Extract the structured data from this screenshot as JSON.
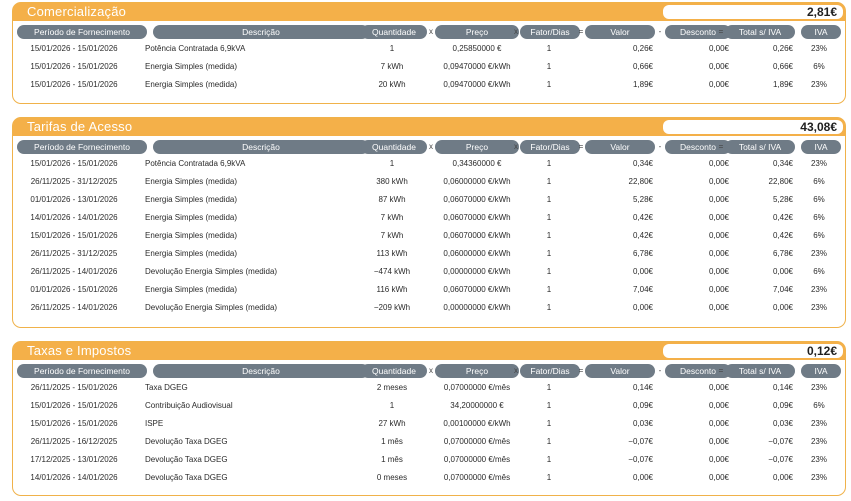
{
  "columns": {
    "periodo": "Período de Fornecimento",
    "descricao": "Descrição",
    "quantidade": "Quantidade",
    "preco": "Preço",
    "fator": "Fator/Dias",
    "valor": "Valor",
    "desconto": "Desconto",
    "total": "Total s/ IVA",
    "iva": "IVA",
    "op_x1": "x",
    "op_x2": "x",
    "op_eq1": "=",
    "op_minus": "-",
    "op_eq2": "="
  },
  "sections": [
    {
      "title": "Comercialização",
      "total": "2,81€",
      "rows": [
        {
          "periodo": "15/01/2026 - 15/01/2026",
          "descricao": "Potência Contratada 6,9kVA",
          "quantidade": "1",
          "preco": "0,25850000 €",
          "fator": "1",
          "valor": "0,26€",
          "desconto": "0,00€",
          "total": "0,26€",
          "iva": "23%"
        },
        {
          "periodo": "15/01/2026 - 15/01/2026",
          "descricao": "Energia Simples (medida)",
          "quantidade": "7 kWh",
          "preco": "0,09470000 €/kWh",
          "fator": "1",
          "valor": "0,66€",
          "desconto": "0,00€",
          "total": "0,66€",
          "iva": "6%"
        },
        {
          "periodo": "15/01/2026 - 15/01/2026",
          "descricao": "Energia Simples (medida)",
          "quantidade": "20 kWh",
          "preco": "0,09470000 €/kWh",
          "fator": "1",
          "valor": "1,89€",
          "desconto": "0,00€",
          "total": "1,89€",
          "iva": "23%"
        }
      ]
    },
    {
      "title": "Tarifas de Acesso",
      "total": "43,08€",
      "rows": [
        {
          "periodo": "15/01/2026 - 15/01/2026",
          "descricao": "Potência Contratada 6,9kVA",
          "quantidade": "1",
          "preco": "0,34360000 €",
          "fator": "1",
          "valor": "0,34€",
          "desconto": "0,00€",
          "total": "0,34€",
          "iva": "23%"
        },
        {
          "periodo": "26/11/2025 - 31/12/2025",
          "descricao": "Energia Simples (medida)",
          "quantidade": "380 kWh",
          "preco": "0,06000000 €/kWh",
          "fator": "1",
          "valor": "22,80€",
          "desconto": "0,00€",
          "total": "22,80€",
          "iva": "6%"
        },
        {
          "periodo": "01/01/2026 - 13/01/2026",
          "descricao": "Energia Simples (medida)",
          "quantidade": "87 kWh",
          "preco": "0,06070000 €/kWh",
          "fator": "1",
          "valor": "5,28€",
          "desconto": "0,00€",
          "total": "5,28€",
          "iva": "6%"
        },
        {
          "periodo": "14/01/2026 - 14/01/2026",
          "descricao": "Energia Simples (medida)",
          "quantidade": "7 kWh",
          "preco": "0,06070000 €/kWh",
          "fator": "1",
          "valor": "0,42€",
          "desconto": "0,00€",
          "total": "0,42€",
          "iva": "6%"
        },
        {
          "periodo": "15/01/2026 - 15/01/2026",
          "descricao": "Energia Simples (medida)",
          "quantidade": "7 kWh",
          "preco": "0,06070000 €/kWh",
          "fator": "1",
          "valor": "0,42€",
          "desconto": "0,00€",
          "total": "0,42€",
          "iva": "6%"
        },
        {
          "periodo": "26/11/2025 - 31/12/2025",
          "descricao": "Energia Simples (medida)",
          "quantidade": "113 kWh",
          "preco": "0,06000000 €/kWh",
          "fator": "1",
          "valor": "6,78€",
          "desconto": "0,00€",
          "total": "6,78€",
          "iva": "23%"
        },
        {
          "periodo": "26/11/2025 - 14/01/2026",
          "descricao": "Devolução Energia Simples (medida)",
          "quantidade": "−474 kWh",
          "preco": "0,00000000 €/kWh",
          "fator": "1",
          "valor": "0,00€",
          "desconto": "0,00€",
          "total": "0,00€",
          "iva": "6%"
        },
        {
          "periodo": "01/01/2026 - 15/01/2026",
          "descricao": "Energia Simples (medida)",
          "quantidade": "116 kWh",
          "preco": "0,06070000 €/kWh",
          "fator": "1",
          "valor": "7,04€",
          "desconto": "0,00€",
          "total": "7,04€",
          "iva": "23%"
        },
        {
          "periodo": "26/11/2025 - 14/01/2026",
          "descricao": "Devolução Energia Simples (medida)",
          "quantidade": "−209 kWh",
          "preco": "0,00000000 €/kWh",
          "fator": "1",
          "valor": "0,00€",
          "desconto": "0,00€",
          "total": "0,00€",
          "iva": "23%"
        }
      ]
    },
    {
      "title": "Taxas e Impostos",
      "total": "0,12€",
      "rows": [
        {
          "periodo": "26/11/2025 - 15/01/2026",
          "descricao": "Taxa DGEG",
          "quantidade": "2 meses",
          "preco": "0,07000000 €/mês",
          "fator": "1",
          "valor": "0,14€",
          "desconto": "0,00€",
          "total": "0,14€",
          "iva": "23%"
        },
        {
          "periodo": "15/01/2026 - 15/01/2026",
          "descricao": "Contribuição Audiovisual",
          "quantidade": "1",
          "preco": "34,20000000 €",
          "fator": "1",
          "valor": "0,09€",
          "desconto": "0,00€",
          "total": "0,09€",
          "iva": "6%"
        },
        {
          "periodo": "15/01/2026 - 15/01/2026",
          "descricao": "ISPE",
          "quantidade": "27 kWh",
          "preco": "0,00100000 €/kWh",
          "fator": "1",
          "valor": "0,03€",
          "desconto": "0,00€",
          "total": "0,03€",
          "iva": "23%"
        },
        {
          "periodo": "26/11/2025 - 16/12/2025",
          "descricao": "Devolução Taxa DGEG",
          "quantidade": "1 mês",
          "preco": "0,07000000 €/mês",
          "fator": "1",
          "valor": "−0,07€",
          "desconto": "0,00€",
          "total": "−0,07€",
          "iva": "23%"
        },
        {
          "periodo": "17/12/2025 - 13/01/2026",
          "descricao": "Devolução Taxa DGEG",
          "quantidade": "1 mês",
          "preco": "0,07000000 €/mês",
          "fator": "1",
          "valor": "−0,07€",
          "desconto": "0,00€",
          "total": "−0,07€",
          "iva": "23%"
        },
        {
          "periodo": "14/01/2026 - 14/01/2026",
          "descricao": "Devolução Taxa DGEG",
          "quantidade": "0 meses",
          "preco": "0,07000000 €/mês",
          "fator": "1",
          "valor": "0,00€",
          "desconto": "0,00€",
          "total": "0,00€",
          "iva": "23%"
        }
      ]
    }
  ]
}
